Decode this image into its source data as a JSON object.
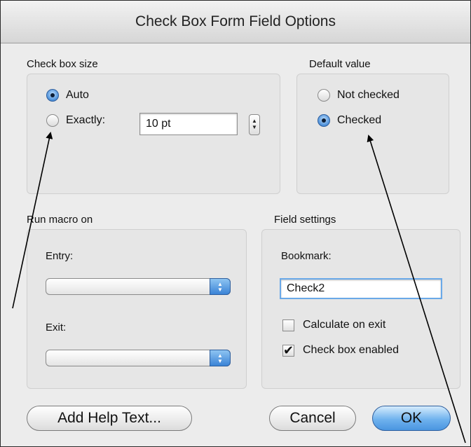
{
  "dialog": {
    "title": "Check Box Form Field Options"
  },
  "check_box_size": {
    "label": "Check box size",
    "auto_label": "Auto",
    "auto_selected": true,
    "exactly_label": "Exactly:",
    "exactly_selected": false,
    "size_value": "10 pt"
  },
  "default_value": {
    "label": "Default value",
    "not_checked_label": "Not checked",
    "not_checked_selected": false,
    "checked_label": "Checked",
    "checked_selected": true
  },
  "run_macro": {
    "label": "Run macro on",
    "entry_label": "Entry:",
    "entry_value": "",
    "exit_label": "Exit:",
    "exit_value": ""
  },
  "field_settings": {
    "label": "Field settings",
    "bookmark_label": "Bookmark:",
    "bookmark_value": "Check2",
    "calculate_label": "Calculate on exit",
    "calculate_checked": false,
    "enabled_label": "Check box enabled",
    "enabled_checked": true
  },
  "buttons": {
    "help": "Add Help Text...",
    "cancel": "Cancel",
    "ok": "OK"
  },
  "colors": {
    "accent": "#4a95e0",
    "window_bg": "#ececec"
  }
}
